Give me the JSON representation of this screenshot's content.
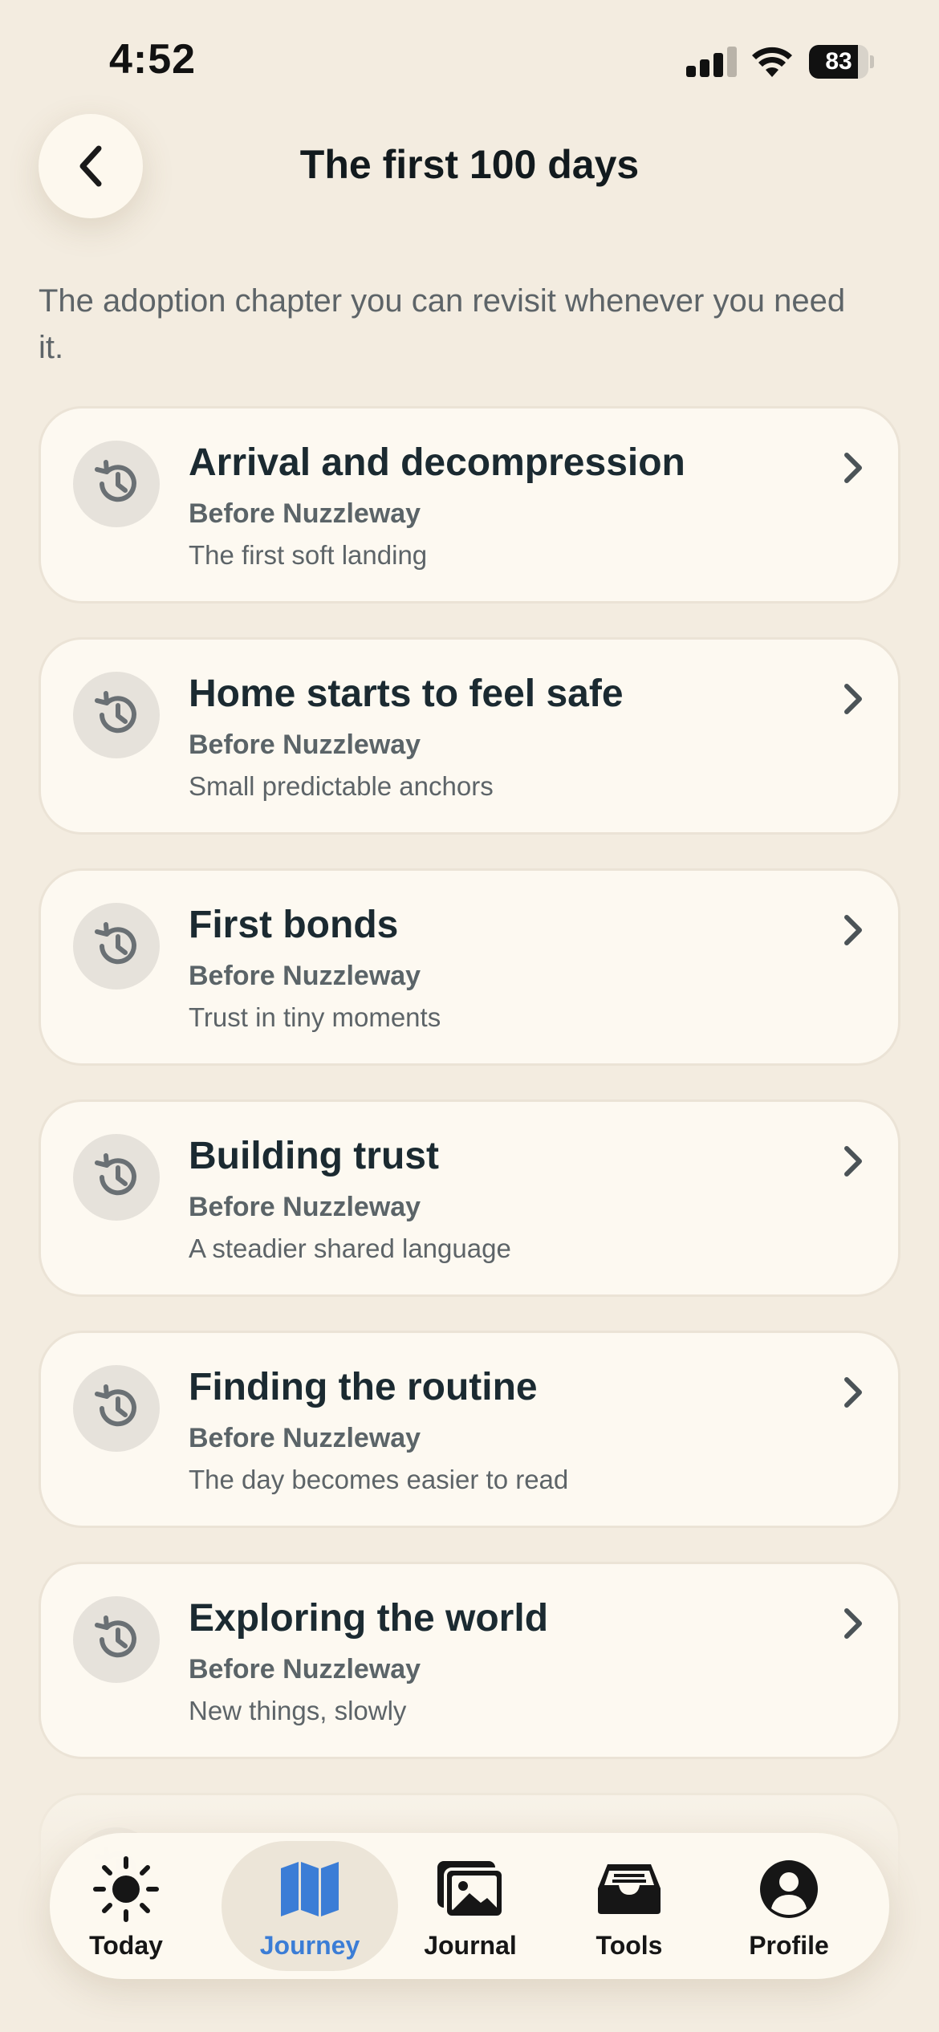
{
  "status": {
    "time": "4:52",
    "battery_level": "83",
    "battery_fraction": 0.83
  },
  "header": {
    "title": "The first 100 days",
    "back_icon": "chevron-left-icon"
  },
  "intro": "The adoption chapter you can revisit whenever you need it.",
  "chapters": [
    {
      "title": "Arrival and decompression",
      "subtitle": "Before Nuzzleway",
      "description": "The first soft landing"
    },
    {
      "title": "Home starts to feel safe",
      "subtitle": "Before Nuzzleway",
      "description": "Small predictable anchors"
    },
    {
      "title": "First bonds",
      "subtitle": "Before Nuzzleway",
      "description": "Trust in tiny moments"
    },
    {
      "title": "Building trust",
      "subtitle": "Before Nuzzleway",
      "description": "A steadier shared language"
    },
    {
      "title": "Finding the routine",
      "subtitle": "Before Nuzzleway",
      "description": "The day becomes easier to read"
    },
    {
      "title": "Exploring the world",
      "subtitle": "Before Nuzzleway",
      "description": "New things, slowly"
    }
  ],
  "tabs": [
    {
      "label": "Today",
      "icon": "sun-icon",
      "active": false
    },
    {
      "label": "Journey",
      "icon": "map-icon",
      "active": true
    },
    {
      "label": "Journal",
      "icon": "photos-icon",
      "active": false
    },
    {
      "label": "Tools",
      "icon": "tray-icon",
      "active": false
    },
    {
      "label": "Profile",
      "icon": "person-circle-icon",
      "active": false
    }
  ],
  "colors": {
    "background": "#f3ece0",
    "card": "#fdf9f1",
    "accent": "#3b7dd6",
    "text": "#1b2a31",
    "muted": "#5d6468"
  }
}
